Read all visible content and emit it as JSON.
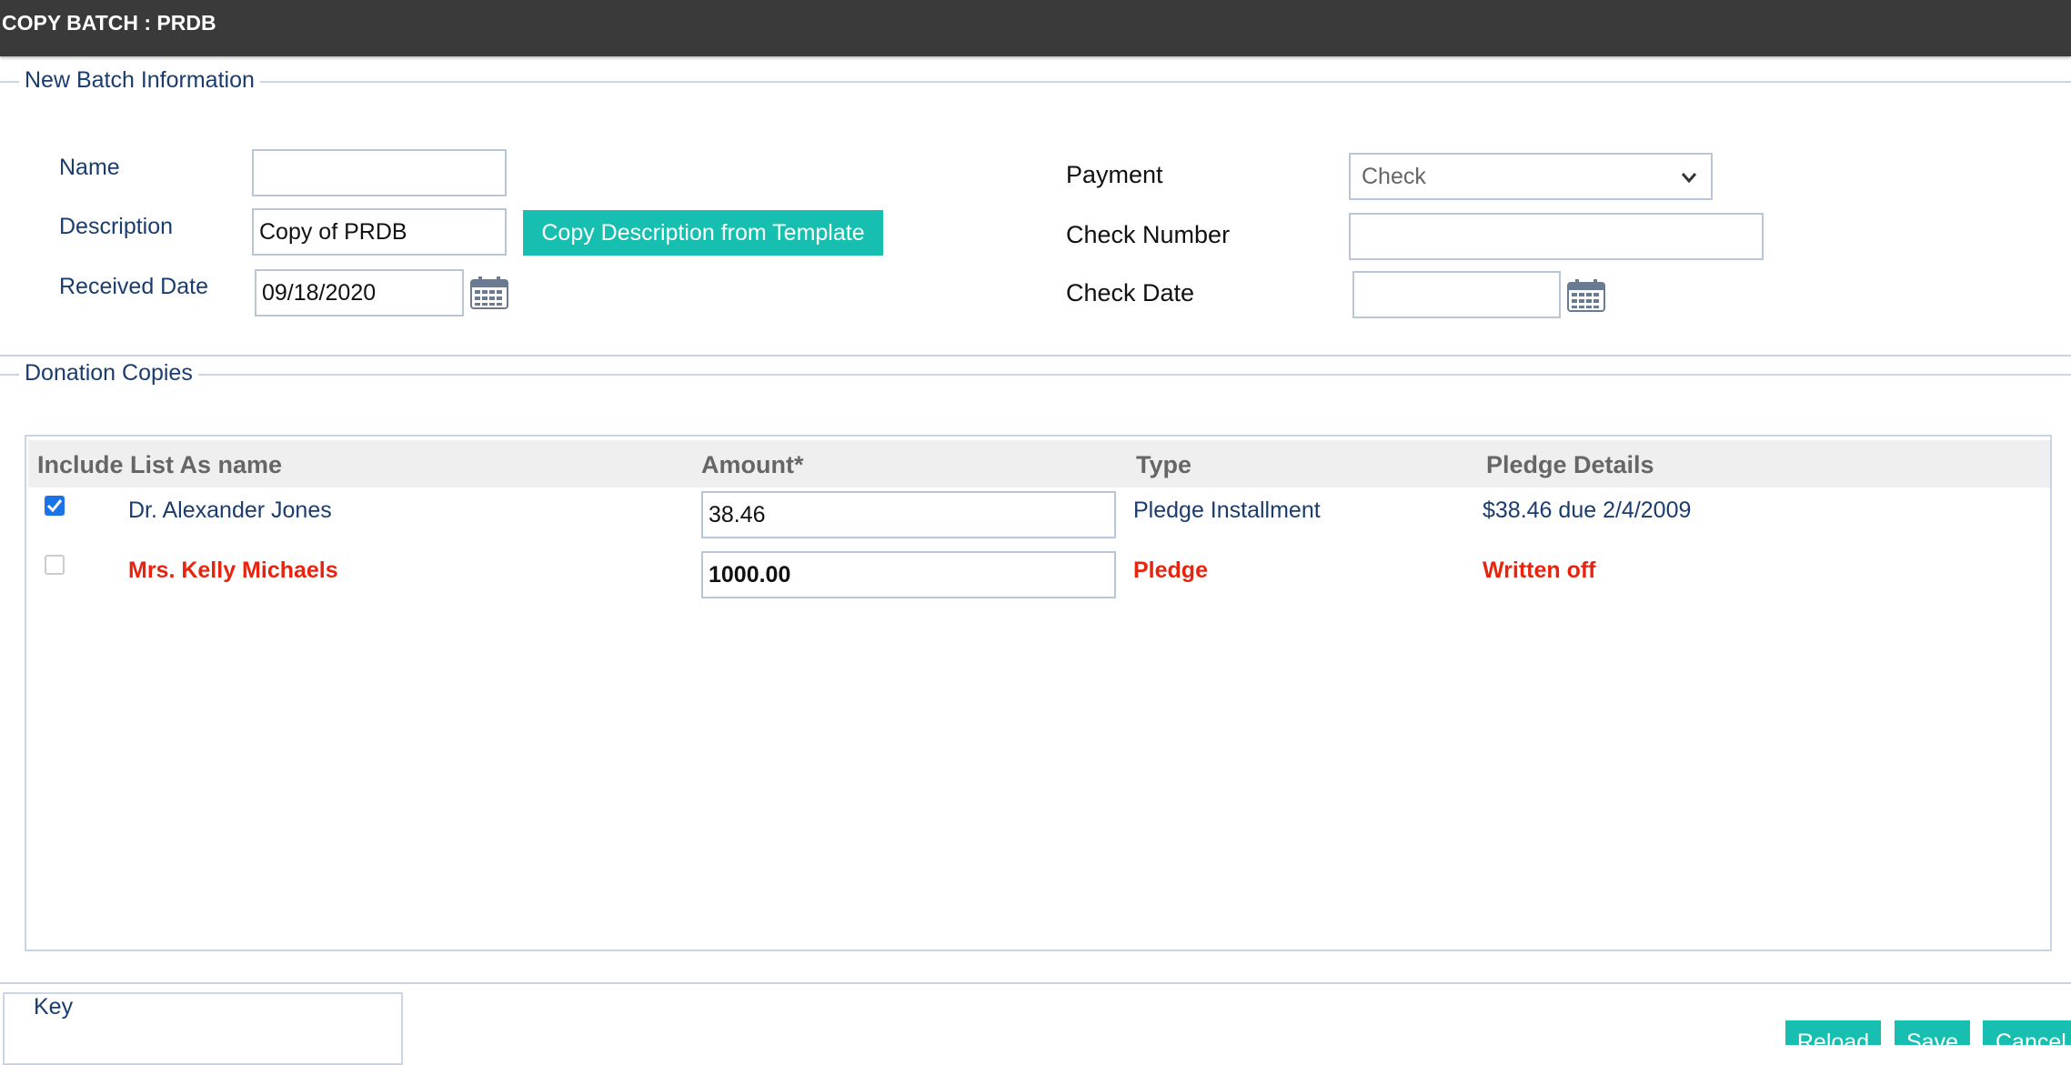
{
  "title": "COPY BATCH : PRDB",
  "batch_info": {
    "legend": "New Batch Information",
    "name_label": "Name",
    "name_value": "",
    "description_label": "Description",
    "description_value": "Copy of PRDB",
    "copy_button": "Copy Description from Template",
    "received_label": "Received Date",
    "received_value": "09/18/2020",
    "payment_label": "Payment",
    "payment_value": "Check",
    "check_number_label": "Check Number",
    "check_number_value": "",
    "check_date_label": "Check Date",
    "check_date_value": ""
  },
  "donations": {
    "legend": "Donation Copies",
    "columns": [
      "Include",
      "List As name",
      "Amount*",
      "Type",
      "Pledge Details"
    ],
    "rows": [
      {
        "include": true,
        "name": "Dr. Alexander Jones",
        "amount": "38.46",
        "type": "Pledge Installment",
        "details": "$38.46 due 2/4/2009",
        "status": "normal"
      },
      {
        "include": false,
        "name": "Mrs. Kelly Michaels",
        "amount": "1000.00",
        "type": "Pledge",
        "details": "Written off",
        "status": "written-off"
      }
    ]
  },
  "key": {
    "label": "Key"
  },
  "actions": {
    "reload": "Reload",
    "save": "Save",
    "cancel": "Cancel"
  },
  "colors": {
    "accent": "#17bfb0",
    "titlebar": "#3a3a3a",
    "text": "#1b3c6e",
    "alert": "#e8230e"
  }
}
